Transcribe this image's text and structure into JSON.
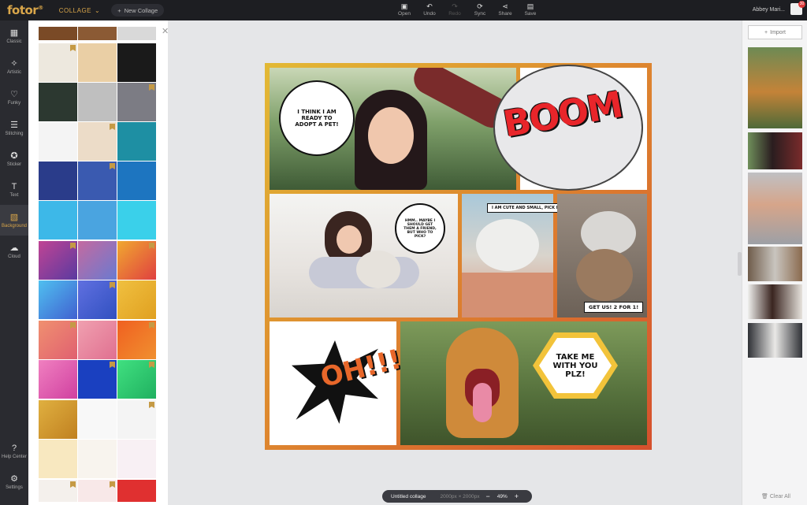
{
  "app": {
    "logo": "fotor",
    "mode": "COLLAGE",
    "new_collage": "New Collage"
  },
  "toolbar": [
    {
      "label": "Open",
      "icon": "open-icon",
      "glyph": "▣",
      "disabled": false
    },
    {
      "label": "Undo",
      "icon": "undo-icon",
      "glyph": "↶",
      "disabled": false
    },
    {
      "label": "Redo",
      "icon": "redo-icon",
      "glyph": "↷",
      "disabled": true
    },
    {
      "label": "Sync",
      "icon": "sync-icon",
      "glyph": "⟳",
      "disabled": false
    },
    {
      "label": "Share",
      "icon": "share-icon",
      "glyph": "⋖",
      "disabled": false
    },
    {
      "label": "Save",
      "icon": "save-icon",
      "glyph": "▤",
      "disabled": false
    }
  ],
  "user": {
    "name": "Abbey Mari...",
    "badge": "30"
  },
  "sidebar": [
    {
      "label": "Classic",
      "icon": "classic-layout-icon",
      "glyph": "▦",
      "active": false
    },
    {
      "label": "Artistic",
      "icon": "artistic-icon",
      "glyph": "✧",
      "active": false
    },
    {
      "label": "Funky",
      "icon": "funky-icon",
      "glyph": "♡",
      "active": false
    },
    {
      "label": "Stitching",
      "icon": "stitching-icon",
      "glyph": "☰",
      "active": false
    },
    {
      "label": "Sticker",
      "icon": "sticker-icon",
      "glyph": "✪",
      "active": false
    },
    {
      "label": "Text",
      "icon": "text-icon",
      "glyph": "T",
      "active": false
    },
    {
      "label": "Background",
      "icon": "background-icon",
      "glyph": "▧",
      "active": true
    },
    {
      "label": "Cloud",
      "icon": "cloud-icon",
      "glyph": "☁",
      "active": false
    }
  ],
  "sidebar_bottom": [
    {
      "label": "Help Center",
      "icon": "help-icon",
      "glyph": "?"
    },
    {
      "label": "Settings",
      "icon": "settings-icon",
      "glyph": "⚙"
    }
  ],
  "collage": {
    "speech_1": "I THINK I AM READY TO ADOPT A PET!",
    "boom": "BOOM",
    "speech_2": "HMM.. MAYBE I SHOULD GET THEM A FRIEND, BUT WHO TO PICK?",
    "speech_3": "I AM CUTE AND SMALL, PICK ME!",
    "speech_4": "GET US! 2 FOR 1!",
    "oh": "OH!!!",
    "speech_5": "TAKE ME WITH YOU PLZ!"
  },
  "right_panel": {
    "import": "Import",
    "clear_all": "Clear All"
  },
  "bottom": {
    "title": "Untitled collage",
    "size": "2000px × 2000px",
    "zoom": "49%",
    "minus": "−",
    "plus": "+"
  }
}
